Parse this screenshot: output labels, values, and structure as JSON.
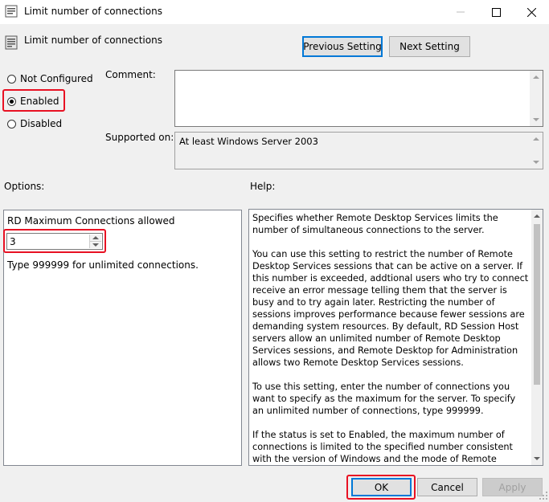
{
  "window": {
    "title": "Limit number of connections",
    "controls": [
      "minimize-icon",
      "maximize-icon",
      "close-icon"
    ]
  },
  "header": {
    "policy_name": "Limit number of connections",
    "prev_button": "Previous Setting",
    "next_button": "Next Setting"
  },
  "state": {
    "options": [
      {
        "label": "Not Configured",
        "selected": false
      },
      {
        "label": "Enabled",
        "selected": true
      },
      {
        "label": "Disabled",
        "selected": false
      }
    ]
  },
  "comment": {
    "label": "Comment:",
    "value": ""
  },
  "supported": {
    "label": "Supported on:",
    "value": "At least Windows Server 2003"
  },
  "options_panel": {
    "label": "Options:",
    "setting_label": "RD Maximum Connections allowed",
    "value": "3",
    "hint": "Type 999999 for unlimited connections."
  },
  "help_panel": {
    "label": "Help:",
    "paragraphs": [
      "Specifies whether Remote Desktop Services limits the number of simultaneous connections to the server.",
      "You can use this setting to restrict the number of Remote Desktop Services sessions that can be active on a server. If this number is exceeded, addtional users who try to connect receive an error message telling them that the server is busy and to try again later. Restricting the number of sessions improves performance because fewer sessions are demanding system resources. By default, RD Session Host servers allow an unlimited number of Remote Desktop Services sessions, and Remote Desktop for Administration allows two Remote Desktop Services sessions.",
      "To use this setting, enter the number of connections you want to specify as the maximum for the server. To specify an unlimited number of connections, type 999999.",
      "If the status is set to Enabled, the maximum number of connections is limited to the specified number consistent with the version of Windows and the mode of Remote Desktop"
    ]
  },
  "footer": {
    "ok": "OK",
    "cancel": "Cancel",
    "apply": "Apply"
  },
  "colors": {
    "highlight": "#e81123",
    "focus": "#0078d7"
  }
}
